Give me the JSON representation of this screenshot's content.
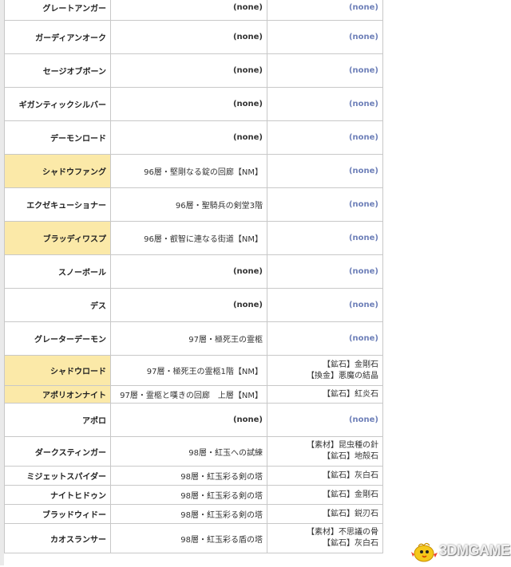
{
  "rows": [
    {
      "name": "グレートアンガー",
      "loc": "(none)",
      "drop": [
        "(none)"
      ],
      "hl": false
    },
    {
      "name": "ガーディアンオーク",
      "loc": "(none)",
      "drop": [
        "(none)"
      ],
      "hl": false
    },
    {
      "name": "セージオブボーン",
      "loc": "(none)",
      "drop": [
        "(none)"
      ],
      "hl": false
    },
    {
      "name": "ギガンティックシルバー",
      "loc": "(none)",
      "drop": [
        "(none)"
      ],
      "hl": false
    },
    {
      "name": "デーモンロード",
      "loc": "(none)",
      "drop": [
        "(none)"
      ],
      "hl": false
    },
    {
      "name": "シャドウファング",
      "loc": "96層・堅剛なる錠の回廊【NM】",
      "drop": [
        "(none)"
      ],
      "hl": true
    },
    {
      "name": "エクゼキューショナー",
      "loc": "96層・聖騎兵の剣堂3階",
      "drop": [
        "(none)"
      ],
      "hl": false
    },
    {
      "name": "ブラッディワスプ",
      "loc": "96層・叡智に連なる街道【NM】",
      "drop": [
        "(none)"
      ],
      "hl": true
    },
    {
      "name": "スノーボール",
      "loc": "(none)",
      "drop": [
        "(none)"
      ],
      "hl": false
    },
    {
      "name": "デス",
      "loc": "(none)",
      "drop": [
        "(none)"
      ],
      "hl": false
    },
    {
      "name": "グレーターデーモン",
      "loc": "97層・極死王の霊柩",
      "drop": [
        "(none)"
      ],
      "hl": false
    },
    {
      "name": "シャドウロード",
      "loc": "97層・極死王の霊柩1階【NM】",
      "drop": [
        "【鉱石】金剛石",
        "【換金】悪魔の結晶"
      ],
      "hl": true
    },
    {
      "name": "アポリオンナイト",
      "loc": "97層・霊柩と嘆きの回廊　上層【NM】",
      "drop": [
        "【鉱石】紅炎石"
      ],
      "hl": true
    },
    {
      "name": "アポロ",
      "loc": "(none)",
      "drop": [
        "(none)"
      ],
      "hl": false
    },
    {
      "name": "ダークスティンガー",
      "loc": "98層・紅玉への試練",
      "drop": [
        "【素材】昆虫種の針",
        "【鉱石】地殻石"
      ],
      "hl": false
    },
    {
      "name": "ミジェットスパイダー",
      "loc": "98層・紅玉彩る剣の塔",
      "drop": [
        "【鉱石】灰白石"
      ],
      "hl": false
    },
    {
      "name": "ナイトヒドゥン",
      "loc": "98層・紅玉彩る剣の塔",
      "drop": [
        "【鉱石】金剛石"
      ],
      "hl": false
    },
    {
      "name": "ブラッドウィドー",
      "loc": "98層・紅玉彩る剣の塔",
      "drop": [
        "【鉱石】鋭刃石"
      ],
      "hl": false
    },
    {
      "name": "カオスランサー",
      "loc": "98層・紅玉彩る盾の塔",
      "drop": [
        "【素材】不思議の骨",
        "【鉱石】灰白石"
      ],
      "hl": false
    }
  ],
  "watermark": {
    "text": "3DMGAME"
  }
}
